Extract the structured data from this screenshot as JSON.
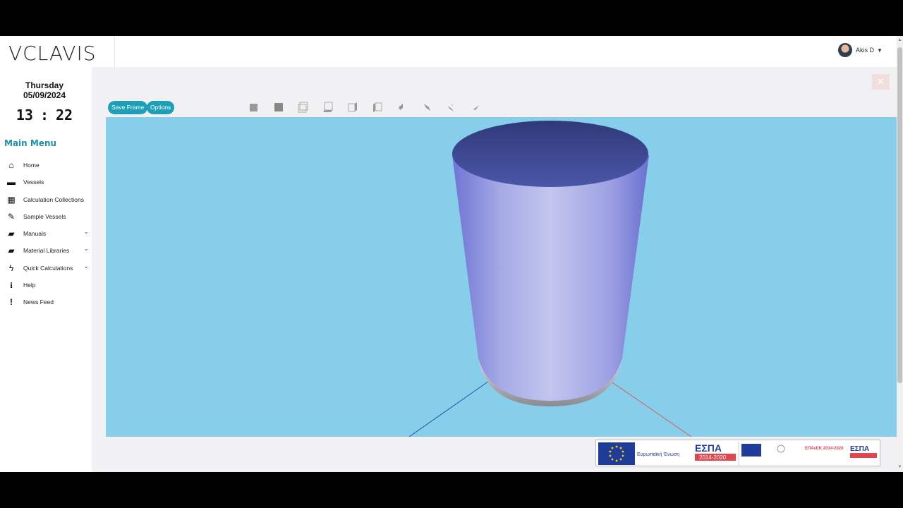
{
  "app": {
    "logo_text": "VCLAVIS"
  },
  "user": {
    "name": "Akis D",
    "caret": "▼"
  },
  "sidebar": {
    "day": "Thursday",
    "date": "05/09/2024",
    "clock": {
      "hours": "13",
      "separator": ":",
      "minutes": "22"
    },
    "menu_title": "Main Menu",
    "items": [
      {
        "label": "Home",
        "icon": "home-icon"
      },
      {
        "label": "Vessels",
        "icon": "archive-icon"
      },
      {
        "label": "Calculation Collections",
        "icon": "qrcode-icon"
      },
      {
        "label": "Sample Vessels",
        "icon": "edit-icon"
      },
      {
        "label": "Manuals",
        "icon": "book-icon",
        "expandable": true
      },
      {
        "label": "Material Libraries",
        "icon": "book-icon",
        "expandable": true
      },
      {
        "label": "Quick Calculations",
        "icon": "bolt-icon",
        "expandable": true
      },
      {
        "label": "Help",
        "icon": "info-icon"
      },
      {
        "label": "News Feed",
        "icon": "exclamation-icon"
      }
    ]
  },
  "toolbar": {
    "save_frame": "Save Frame",
    "options": "Options",
    "view_icons": [
      "view-front-icon",
      "view-back-icon",
      "view-top-icon",
      "view-bottom-icon",
      "view-left-icon",
      "view-right-icon",
      "view-iso-1-icon",
      "view-iso-2-icon",
      "view-iso-3-icon",
      "view-iso-4-icon"
    ]
  },
  "viewer": {
    "close_label": "✕",
    "background_color": "#87ceeb",
    "vessel_color": "#8f94e0"
  },
  "banner": {
    "eu_text": "Ευρωπαϊκή Ένωση",
    "espa_text": "ΕΣΠΑ",
    "espa_years": "2014-2020",
    "epanek_text": "ΕΠΑνΕΚ 2014-2020"
  }
}
